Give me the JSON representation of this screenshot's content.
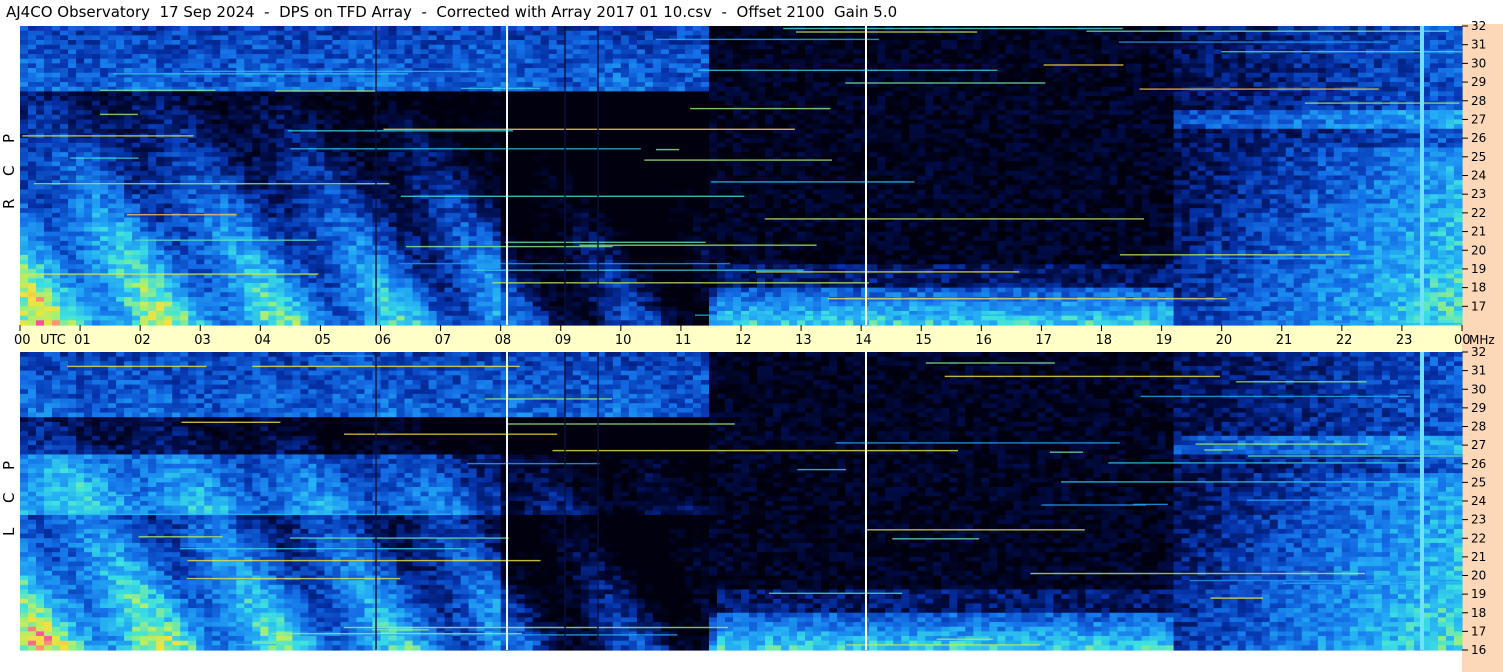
{
  "title": "AJ4CO Observatory  17 Sep 2024  -  DPS on TFD Array  -  Corrected with Array 2017 01 10.csv  -  Offset 2100  Gain 5.0",
  "chart_data": {
    "type": "heatmap",
    "title": "AJ4CO Observatory  17 Sep 2024  -  DPS on TFD Array  -  Corrected with Array 2017 01 10.csv  -  Offset 2100  Gain 5.0",
    "time_axis": {
      "unit": "UTC",
      "ticks": [
        "00",
        "01",
        "02",
        "03",
        "04",
        "05",
        "06",
        "07",
        "08",
        "09",
        "10",
        "11",
        "12",
        "13",
        "14",
        "15",
        "16",
        "17",
        "18",
        "19",
        "20",
        "21",
        "22",
        "23",
        "00"
      ],
      "range": [
        0,
        24
      ]
    },
    "freq_axis": {
      "unit": "MHz",
      "ticks": [
        "16",
        "17",
        "18",
        "19",
        "20",
        "21",
        "22",
        "23",
        "24",
        "25",
        "26",
        "27",
        "28",
        "29",
        "30",
        "31",
        "32"
      ],
      "range": [
        16,
        32
      ]
    },
    "panels": [
      {
        "name": "R C P",
        "letters": [
          "R",
          "C",
          "P"
        ]
      },
      {
        "name": "L C P",
        "letters": [
          "L",
          "C",
          "P"
        ]
      }
    ],
    "labels": {
      "utc": "UTC",
      "mhz": "MHz"
    }
  }
}
